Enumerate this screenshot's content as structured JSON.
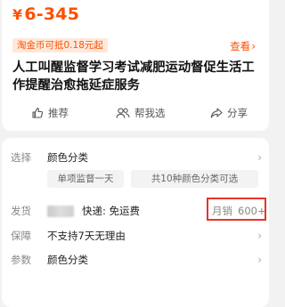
{
  "product": {
    "price_symbol": "¥",
    "price": "6-345",
    "coin_tag": "淘金币可抵0.18元起",
    "view_link": "查看",
    "title": "人工叫醒监督学习考试减肥运动督促生活工作提醒治愈拖延症服务"
  },
  "actions": [
    {
      "label": "推荐",
      "icon": "thumbs-up-icon"
    },
    {
      "label": "帮我选",
      "icon": "people-icon"
    },
    {
      "label": "分享",
      "icon": "share-icon"
    }
  ],
  "details": {
    "select": {
      "label": "选择",
      "value": "颜色分类",
      "options": [
        "单项监督一天",
        "共10种颜色分类可选"
      ]
    },
    "shipping": {
      "label": "发货",
      "text": "快递: 免运费",
      "sales_label": "月销",
      "sales_value": "600+"
    },
    "guarantee": {
      "label": "保障",
      "value": "不支持7天无理由"
    },
    "params": {
      "label": "参数",
      "value": "颜色分类"
    }
  },
  "colors": {
    "accent": "#ff4f00",
    "highlight_box": "#e8332b"
  }
}
